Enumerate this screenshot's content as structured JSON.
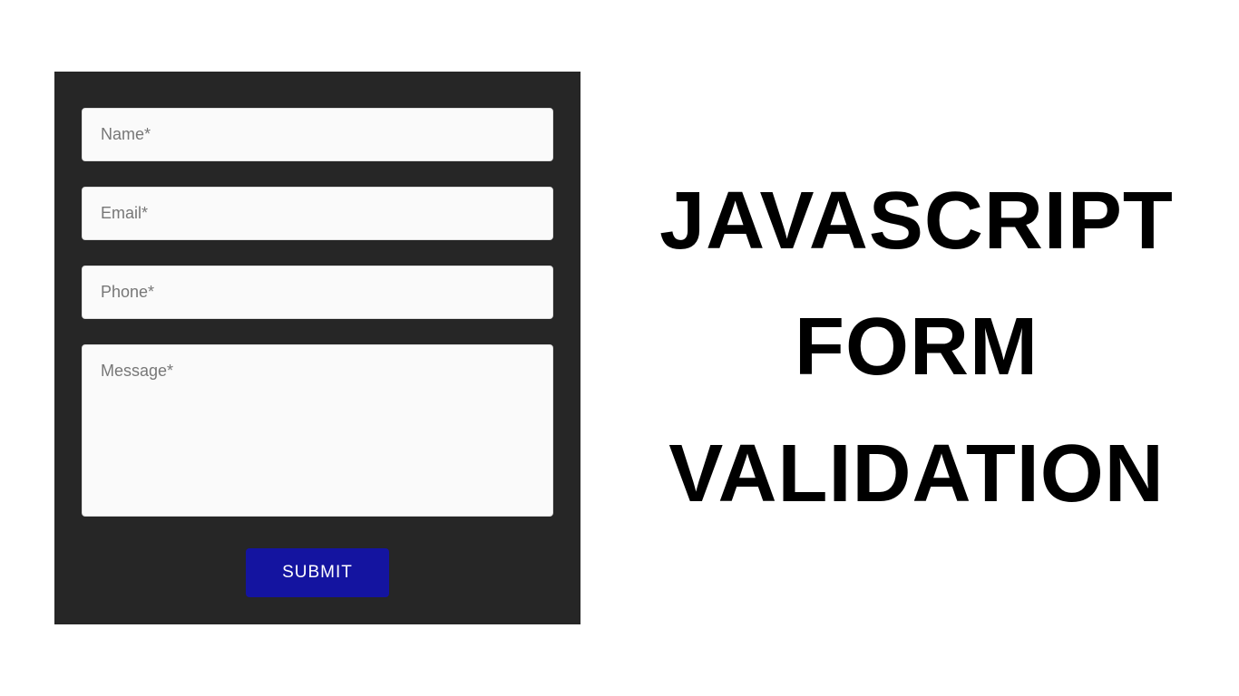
{
  "form": {
    "name_placeholder": "Name*",
    "email_placeholder": "Email*",
    "phone_placeholder": "Phone*",
    "message_placeholder": "Message*",
    "submit_label": "SUBMIT"
  },
  "title": {
    "line1": "JAVASCRIPT",
    "line2": "FORM",
    "line3": "VALIDATION"
  }
}
